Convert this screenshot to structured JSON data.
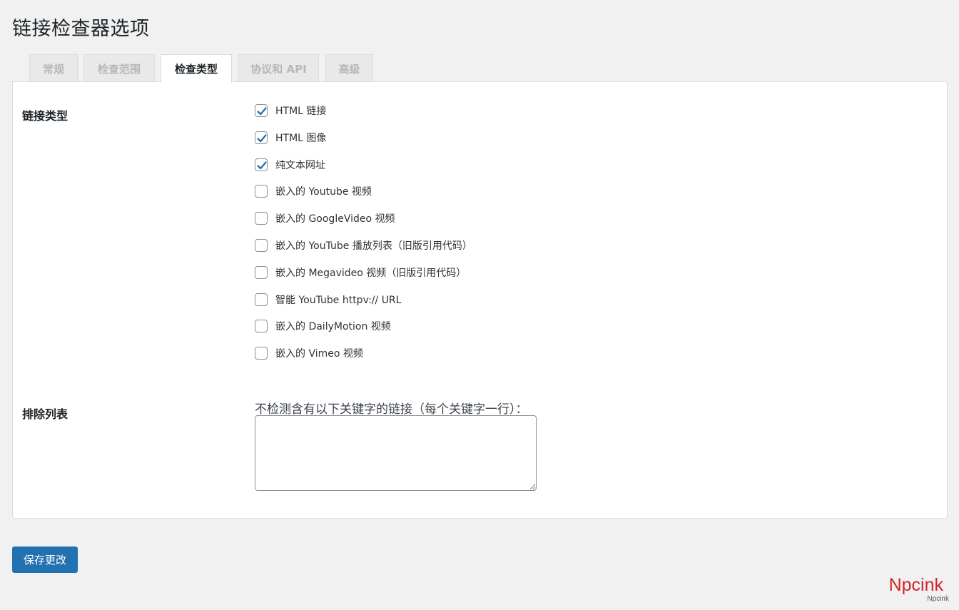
{
  "page": {
    "title": "链接检查器选项"
  },
  "tabs": [
    {
      "label": "常规",
      "active": false
    },
    {
      "label": "检查范围",
      "active": false
    },
    {
      "label": "检查类型",
      "active": true
    },
    {
      "label": "协议和 API",
      "active": false
    },
    {
      "label": "高级",
      "active": false
    }
  ],
  "link_types": {
    "label": "链接类型",
    "options": [
      {
        "label": "HTML 链接",
        "checked": true
      },
      {
        "label": "HTML 图像",
        "checked": true
      },
      {
        "label": "纯文本网址",
        "checked": true
      },
      {
        "label": "嵌入的 Youtube 视频",
        "checked": false
      },
      {
        "label": "嵌入的 GoogleVideo 视频",
        "checked": false
      },
      {
        "label": "嵌入的 YouTube 播放列表（旧版引用代码）",
        "checked": false
      },
      {
        "label": "嵌入的 Megavideo 视频（旧版引用代码）",
        "checked": false
      },
      {
        "label": "智能 YouTube httpv:// URL",
        "checked": false
      },
      {
        "label": "嵌入的 DailyMotion 视频",
        "checked": false
      },
      {
        "label": "嵌入的 Vimeo 视频",
        "checked": false
      }
    ]
  },
  "exclusion": {
    "label": "排除列表",
    "hint": "不检测含有以下关键字的链接（每个关键字一行）：",
    "value": ""
  },
  "save_button": {
    "label": "保存更改"
  },
  "watermark": {
    "main": "Npcink",
    "sub": "Npcink"
  },
  "colors": {
    "accent": "#2271b1",
    "check": "#2271b1",
    "watermark": "#d2232a"
  }
}
